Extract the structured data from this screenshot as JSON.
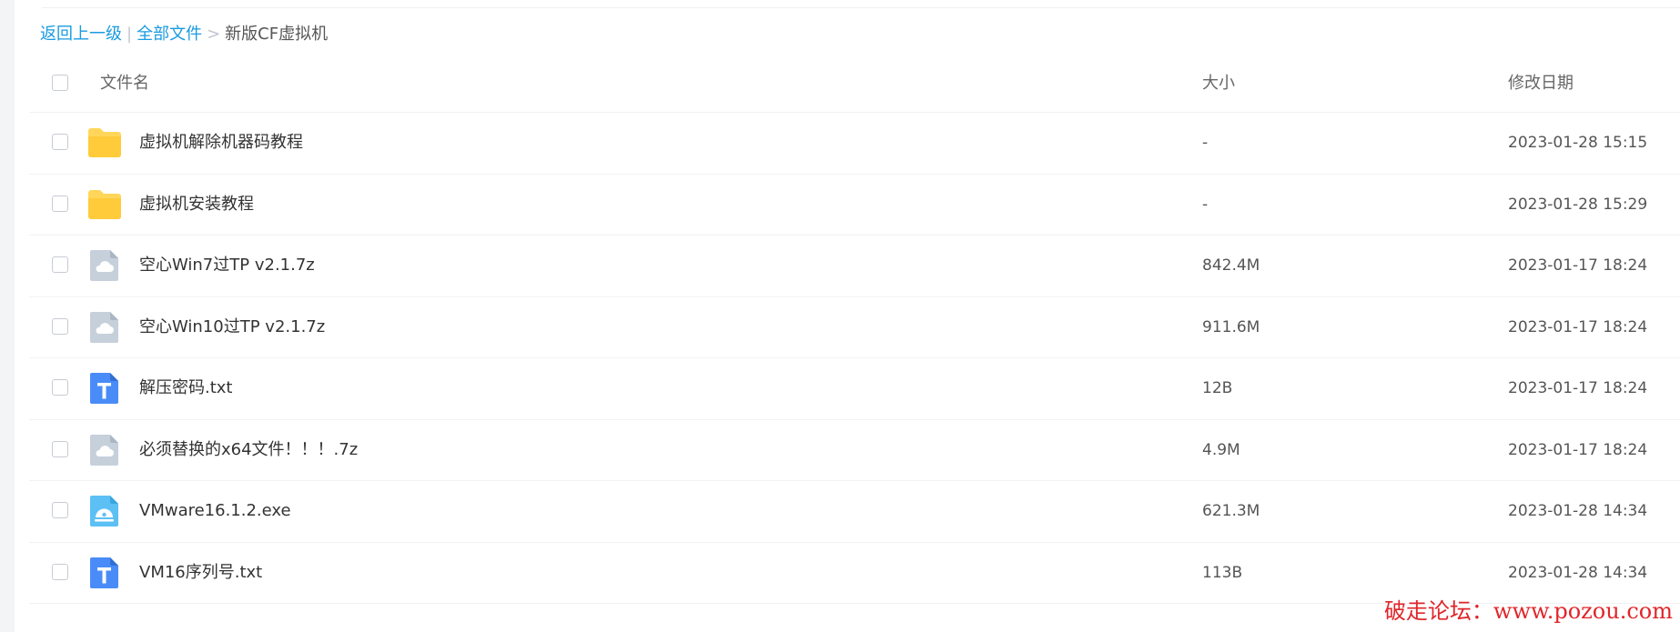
{
  "breadcrumb": {
    "back": "返回上一级",
    "separator_bar": "|",
    "all_files": "全部文件",
    "separator_arrow": ">",
    "current": "新版CF虚拟机"
  },
  "columns": {
    "name": "文件名",
    "size": "大小",
    "date": "修改日期"
  },
  "files": [
    {
      "icon": "folder-icon",
      "name": "虚拟机解除机器码教程",
      "size": "-",
      "date": "2023-01-28 15:15"
    },
    {
      "icon": "folder-icon",
      "name": "虚拟机安装教程",
      "size": "-",
      "date": "2023-01-28 15:29"
    },
    {
      "icon": "archive-icon",
      "name": "空心Win7过TP v2.1.7z",
      "size": "842.4M",
      "date": "2023-01-17 18:24"
    },
    {
      "icon": "archive-icon",
      "name": "空心Win10过TP v2.1.7z",
      "size": "911.6M",
      "date": "2023-01-17 18:24"
    },
    {
      "icon": "text-file-icon",
      "name": "解压密码.txt",
      "size": "12B",
      "date": "2023-01-17 18:24"
    },
    {
      "icon": "archive-icon",
      "name": "必须替换的x64文件！！！.7z",
      "size": "4.9M",
      "date": "2023-01-17 18:24"
    },
    {
      "icon": "exe-file-icon",
      "name": "VMware16.1.2.exe",
      "size": "621.3M",
      "date": "2023-01-28 14:34"
    },
    {
      "icon": "text-file-icon",
      "name": "VM16序列号.txt",
      "size": "113B",
      "date": "2023-01-28 14:34"
    }
  ],
  "watermark": "破走论坛：www.pozou.com",
  "colors": {
    "link": "#1a9bdf",
    "folder": "#ffd659",
    "archive": "#c6d0db",
    "text_file": "#4a8cf7",
    "exe_file": "#5cc0f5",
    "watermark": "#e0262a"
  }
}
